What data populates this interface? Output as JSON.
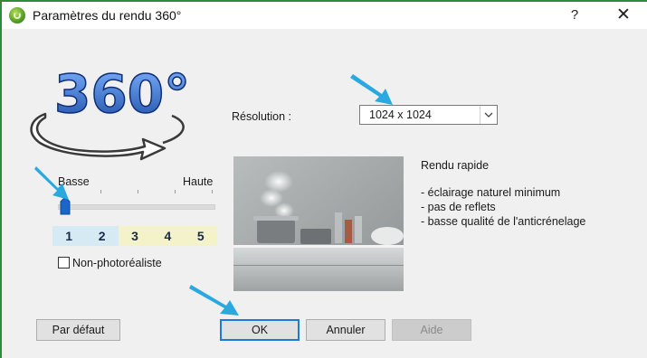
{
  "window": {
    "title": "Paramètres du rendu 360°",
    "help_label": "?",
    "close_label": "✕"
  },
  "logo": {
    "text": "360°"
  },
  "resolution": {
    "label": "Résolution :",
    "selected": "1024 x 1024"
  },
  "quality": {
    "low_label": "Basse",
    "high_label": "Haute",
    "levels": [
      "1",
      "2",
      "3",
      "4",
      "5"
    ],
    "selected_level": 1
  },
  "non_photorealistic": {
    "label": "Non-photoréaliste",
    "checked": false
  },
  "description": {
    "title": "Rendu rapide",
    "lines": [
      "- éclairage naturel minimum",
      "- pas de reflets",
      "- basse qualité de l'anticrénelage"
    ]
  },
  "buttons": {
    "default": "Par défaut",
    "ok": "OK",
    "cancel": "Annuler",
    "help": "Aide"
  },
  "colors": {
    "accent_arrow": "#29a9e0",
    "ok_border": "#1e7ad7",
    "level_group_1": "#d6eaf3",
    "level_group_2": "#f4f2c8"
  }
}
